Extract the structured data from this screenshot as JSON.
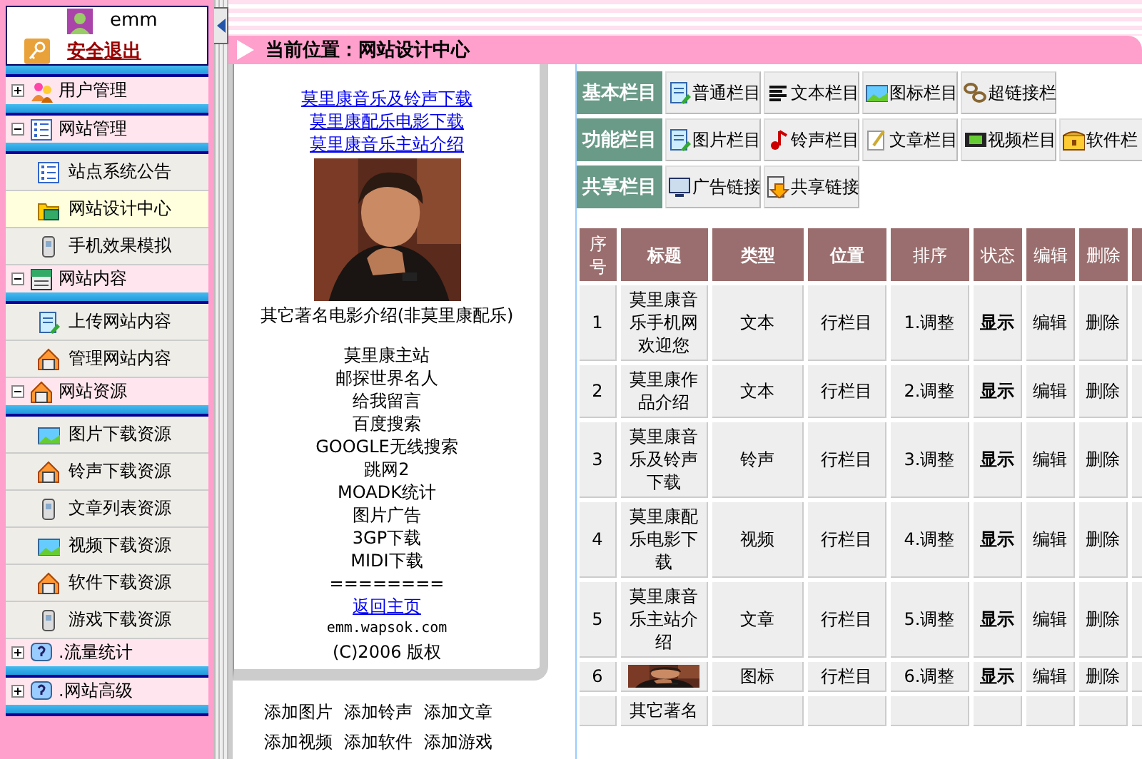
{
  "sidebar": {
    "user": {
      "name": "emm",
      "logout": "安全退出"
    },
    "groups": [
      {
        "label": "用户管理",
        "expanded": false
      },
      {
        "label": "网站管理",
        "expanded": true,
        "children": [
          {
            "label": "站点系统公告",
            "selected": false
          },
          {
            "label": "网站设计中心",
            "selected": true
          },
          {
            "label": "手机效果模拟",
            "selected": false
          }
        ]
      },
      {
        "label": "网站内容",
        "expanded": true,
        "children": [
          {
            "label": "上传网站内容",
            "selected": false
          },
          {
            "label": "管理网站内容",
            "selected": false
          }
        ]
      },
      {
        "label": "网站资源",
        "expanded": true,
        "children": [
          {
            "label": "图片下载资源",
            "selected": false
          },
          {
            "label": "铃声下载资源",
            "selected": false
          },
          {
            "label": "文章列表资源",
            "selected": false
          },
          {
            "label": "视频下载资源",
            "selected": false
          },
          {
            "label": "软件下载资源",
            "selected": false
          },
          {
            "label": "游戏下载资源",
            "selected": false
          }
        ]
      },
      {
        "label": ".流量统计",
        "expanded": false
      },
      {
        "label": ".网站高级",
        "expanded": false
      }
    ]
  },
  "breadcrumb": "当前位置：网站设计中心",
  "preview": {
    "lines": [
      {
        "kind": "gap"
      },
      {
        "kind": "link",
        "text": "莫里康音乐及铃声下载"
      },
      {
        "kind": "link",
        "text": "莫里康配乐电影下载"
      },
      {
        "kind": "link",
        "text": "莫里康音乐主站介绍"
      },
      {
        "kind": "picture"
      },
      {
        "kind": "text",
        "text": "其它著名电影介绍(非莫里康配乐)"
      },
      {
        "kind": "gap"
      },
      {
        "kind": "text",
        "text": "莫里康主站"
      },
      {
        "kind": "text",
        "text": "邮探世界名人"
      },
      {
        "kind": "text",
        "text": "给我留言"
      },
      {
        "kind": "text",
        "text": "百度搜索"
      },
      {
        "kind": "text",
        "text": "GOOGLE无线搜索"
      },
      {
        "kind": "text",
        "text": "跳网2"
      },
      {
        "kind": "text",
        "text": "MOADK统计"
      },
      {
        "kind": "text",
        "text": "图片广告"
      },
      {
        "kind": "text",
        "text": "3GP下载"
      },
      {
        "kind": "text",
        "text": "MIDI下载"
      },
      {
        "kind": "text",
        "text": "========"
      },
      {
        "kind": "link",
        "text": "返回主页"
      },
      {
        "kind": "small",
        "text": "emm.wapsok.com"
      },
      {
        "kind": "text",
        "text": "(C)2006 版权"
      }
    ],
    "add_links": [
      [
        "添加图片",
        "添加铃声",
        "添加文章"
      ],
      [
        "添加视频",
        "添加软件",
        "添加游戏"
      ]
    ]
  },
  "toolbar": [
    {
      "label": "基本栏目",
      "buttons": [
        "普通栏目",
        "文本栏目",
        "图标栏目",
        "超链接栏"
      ]
    },
    {
      "label": "功能栏目",
      "buttons": [
        "图片栏目",
        "铃声栏目",
        "文章栏目",
        "视频栏目",
        "软件栏"
      ]
    },
    {
      "label": "共享栏目",
      "buttons": [
        "广告链接",
        "共享链接"
      ]
    }
  ],
  "table": {
    "columns": [
      {
        "label": "序号",
        "bold": false
      },
      {
        "label": "标题",
        "bold": true
      },
      {
        "label": "类型",
        "bold": true
      },
      {
        "label": "位置",
        "bold": true
      },
      {
        "label": "排序",
        "bold": false
      },
      {
        "label": "状态",
        "bold": false
      },
      {
        "label": "编辑",
        "bold": false
      },
      {
        "label": "删除",
        "bold": false
      }
    ],
    "rows": [
      {
        "no": "1",
        "title": "莫里康音乐手机网欢迎您",
        "type": "文本",
        "position": "行栏目",
        "order": "1.调整",
        "status": "显示",
        "edit": "编辑",
        "delete": "删除"
      },
      {
        "no": "2",
        "title": "莫里康作品介绍",
        "type": "文本",
        "position": "行栏目",
        "order": "2.调整",
        "status": "显示",
        "edit": "编辑",
        "delete": "删除"
      },
      {
        "no": "3",
        "title": "莫里康音乐及铃声下载",
        "type": "铃声",
        "position": "行栏目",
        "order": "3.调整",
        "status": "显示",
        "edit": "编辑",
        "delete": "删除"
      },
      {
        "no": "4",
        "title": "莫里康配乐电影下载",
        "type": "视频",
        "position": "行栏目",
        "order": "4.调整",
        "status": "显示",
        "edit": "编辑",
        "delete": "删除"
      },
      {
        "no": "5",
        "title": "莫里康音乐主站介绍",
        "type": "文章",
        "position": "行栏目",
        "order": "5.调整",
        "status": "显示",
        "edit": "编辑",
        "delete": "删除"
      },
      {
        "no": "6",
        "thumbnail": {
          "kind": "picture"
        },
        "type": "图标",
        "position": "行栏目",
        "order": "6.调整",
        "status": "显示",
        "edit": "编辑",
        "delete": "删除"
      },
      {
        "title": "其它著名"
      }
    ]
  }
}
